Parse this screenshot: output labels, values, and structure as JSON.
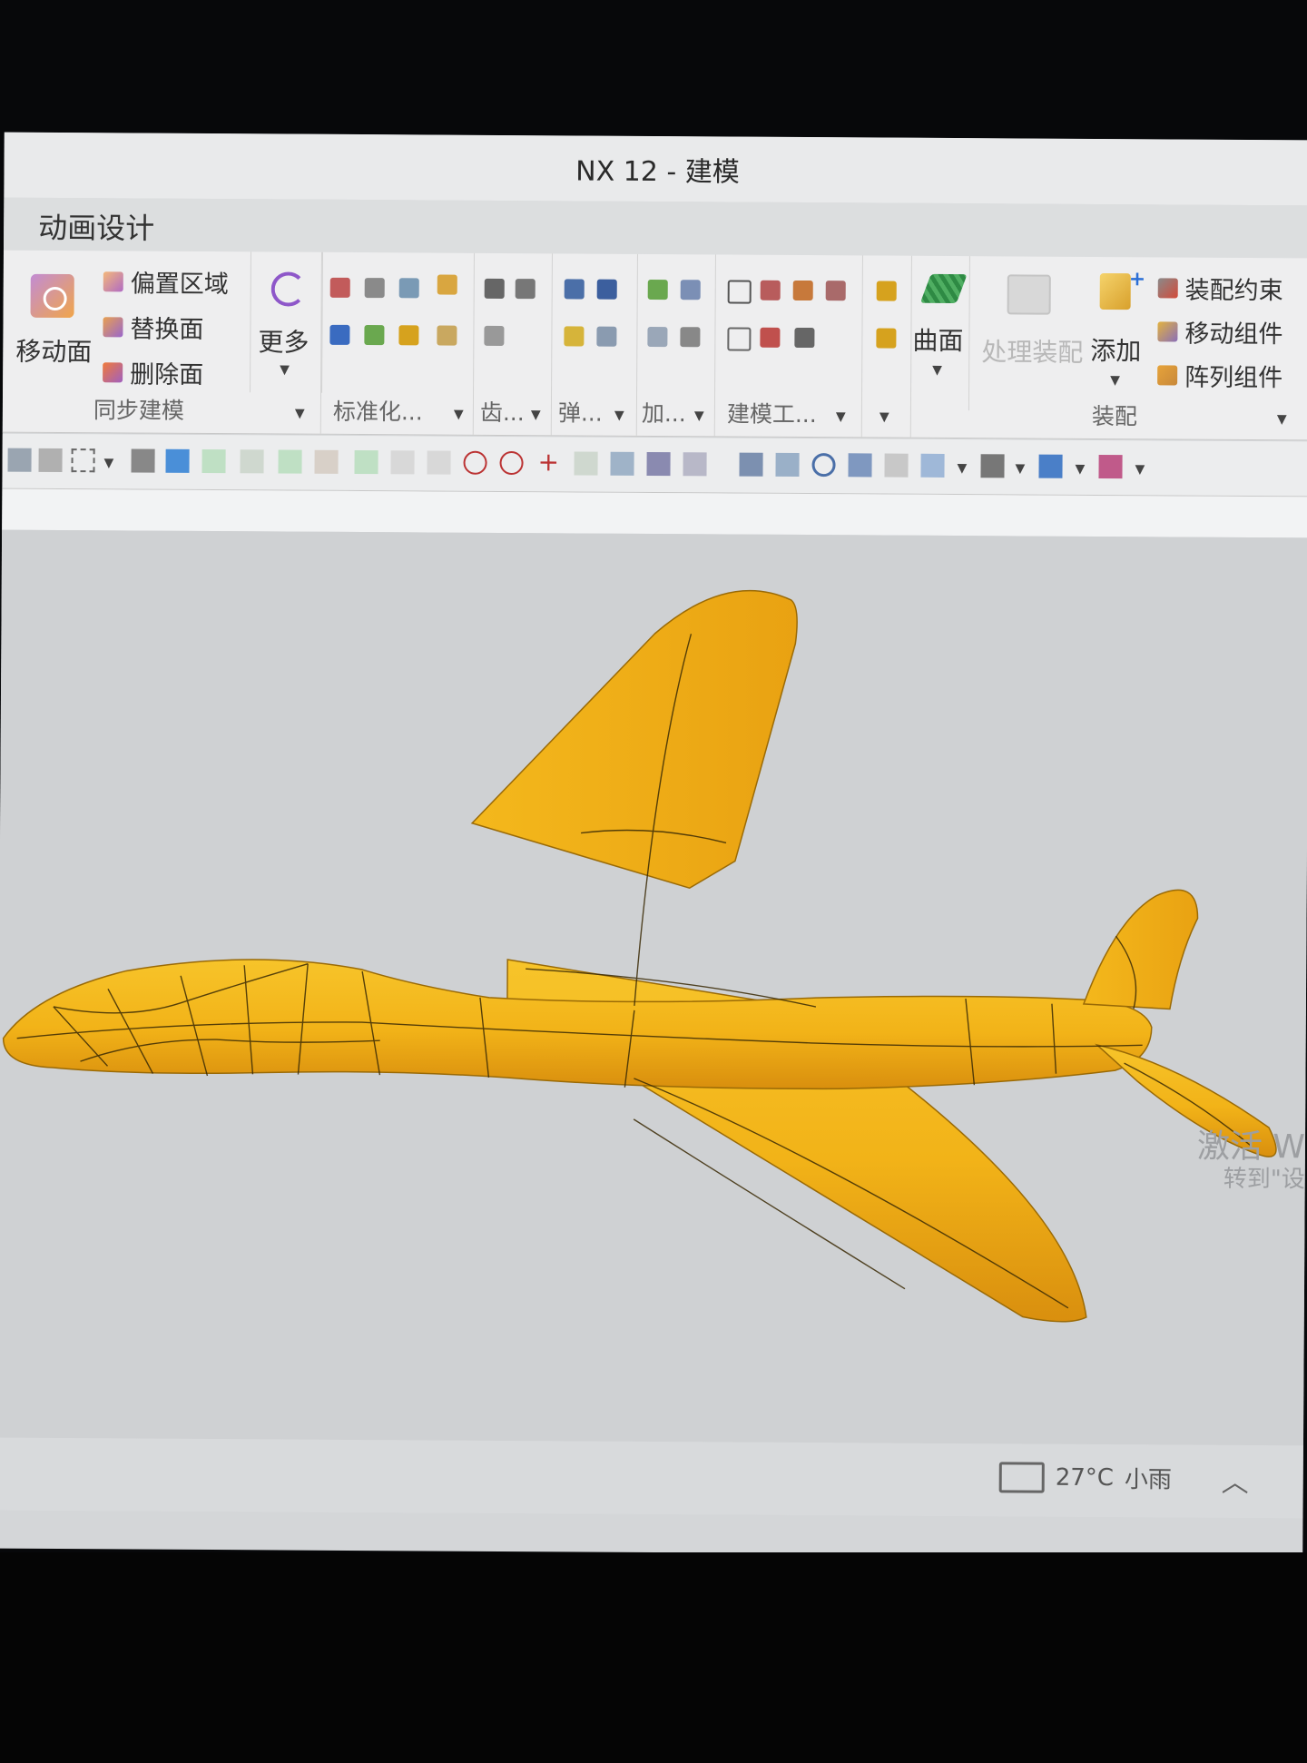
{
  "window": {
    "title": "NX 12 - 建模"
  },
  "tabs": {
    "active": "动画设计"
  },
  "ribbon": {
    "sync_modeling": {
      "label": "同步建模",
      "move_face": "移动面",
      "offset_region": "偏置区域",
      "replace_face": "替换面",
      "delete_face": "删除面",
      "more": "更多"
    },
    "groups": {
      "standardize": "标准化...",
      "gear": "齿...",
      "spring": "弹...",
      "add": "加...",
      "modeling_tools": "建模工..."
    },
    "surface": {
      "label": "曲面"
    },
    "assembly": {
      "label": "装配",
      "process_assembly": "处理装配",
      "add": "添加",
      "constraint": "装配约束",
      "move_component": "移动组件",
      "array_component": "阵列组件"
    }
  },
  "watermark": {
    "line1": "激活 W",
    "line2": "转到\"设"
  },
  "taskbar": {
    "temperature": "27°C",
    "condition": "小雨"
  },
  "colors": {
    "model_yellow": "#f2b318",
    "viewport_bg": "#cfd1d3",
    "ribbon_bg": "#eeeeef"
  },
  "icons": [
    "move-face-icon",
    "offset-region-icon",
    "replace-face-icon",
    "delete-face-icon",
    "more-icon",
    "surface-icon",
    "process-assembly-icon",
    "add-component-icon",
    "assembly-constraint-icon",
    "move-component-icon",
    "array-component-icon",
    "weather-icon",
    "chevron-up-icon"
  ]
}
